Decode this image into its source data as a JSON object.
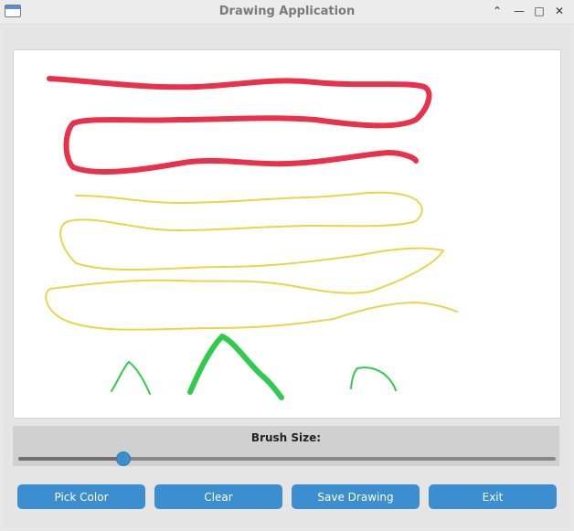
{
  "window": {
    "title": "Drawing Application",
    "controls": {
      "minimize_icon": "chevron-up-icon",
      "hide_icon": "minimize-icon",
      "maximize_icon": "maximize-icon",
      "close_icon": "close-icon"
    }
  },
  "colors": {
    "accent": "#3b8ed0",
    "stroke_red": "#e8314a",
    "stroke_yellow": "#e8d64a",
    "stroke_green": "#2ecc4a"
  },
  "brush": {
    "label": "Brush Size:",
    "value_fraction": 0.195
  },
  "buttons": {
    "pick_color": "Pick Color",
    "clear": "Clear",
    "save": "Save Drawing",
    "exit": "Exit"
  }
}
